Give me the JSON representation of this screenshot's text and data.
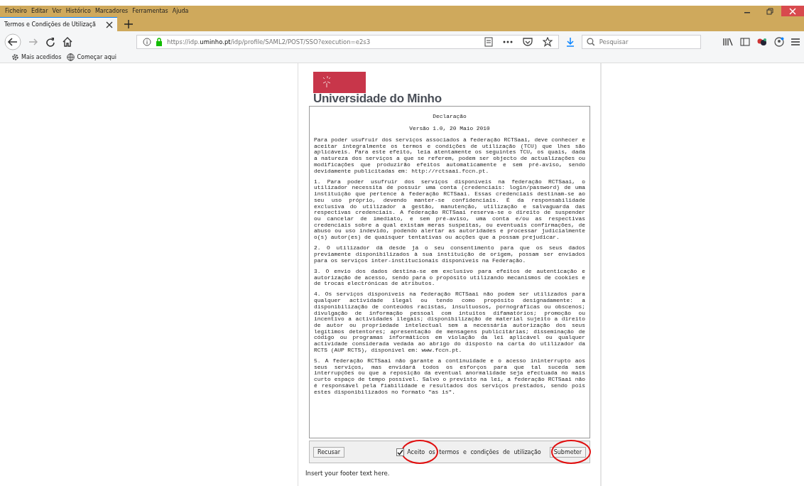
{
  "browser": {
    "menu": [
      "Ficheiro",
      "Editar",
      "Ver",
      "Histórico",
      "Marcadores",
      "Ferramentas",
      "Ajuda"
    ],
    "tab": {
      "title": "Termos e Condições de Utilizaçã",
      "selected": true
    },
    "url": {
      "start": "https://idp.",
      "domain": "uminho.pt",
      "path": "/idp/profile/SAML2/POST/SSO?execution=e2s3"
    },
    "search": {
      "placeholder": "Pesquisar"
    },
    "bookmarks": [
      "Mais acedidos",
      "Começar aqui"
    ]
  },
  "page": {
    "logo_text": "Universidade do Minho",
    "declaration": {
      "title": "Declaração",
      "version": "Versão 1.0, 20 Maio 2010",
      "paragraphs": [
        "Para poder usufruir dos serviços associados à federação RCTSaai, deve conhecer e aceitar integralmente os termos e condições de utilização (TCU) que lhes são aplicáveis. Para este efeito, leia atentamente os seguintes TCU, os quais, dada a natureza dos serviços a que se referem, podem ser objecto de actualizações ou modificações que produzirão efeitos automaticamente e sem pré-aviso, sendo devidamente publicitadas em: http://rctsaai.fccn.pt.",
        "1. Para poder usufruir dos serviços disponíveis na federação RCTSaai, o utilizador necessita de possuir uma conta (credenciais: login/password) de uma instituição que pertence à federação RCTSaai. Essas credenciais destinam-se ao seu uso próprio, devendo manter-se confidenciais. É da responsabilidade exclusiva do utilizador a gestão, manutenção, utilização e salvaguarda das respectivas credenciais. A federação RCTSaai reserva-se o direito de suspender ou cancelar de imediato, e sem pré-aviso, uma conta e/ou as respectivas credenciais sobre a qual existam meras suspeitas, ou eventuais confirmações, de abuso ou uso indevido, podendo alertar as autoridades e processar judicialmente o(s) autor(es) de quaisquer tentativas ou acções que a possam prejudicar.",
        "2. O utilizador dá desde já o seu consentimento para que os seus dados previamente disponibilizados à sua instituição de origem, possam ser enviados para os serviços inter-institucionais disponíveis na Federação.",
        "3. O envio dos dados destina-se em exclusivo para efeitos de autenticação e autorização de acesso, sendo para o propósito utilizando mecanismos de cookies e de trocas electrónicas de atributos.",
        "4. Os serviços disponíveis na federação RCTSaai não podem ser utilizados para qualquer actividade ilegal ou tendo como propósito designadamente: a disponibilização de conteúdos racistas, insultuosos, pornográficas ou obscenos; divulgação de informação pessoal com intuitos difamatórios; promoção ou incentivo a actividades ilegais; disponibilização de material sujeito a direito de autor ou propriedade intelectual sem a necessária autorização dos seus legítimos detentores; apresentação de mensagens publicitárias; disseminação de código ou programas informáticos em violação da lei aplicável ou qualquer actividade considerada vedada ao abrigo do disposto na carta do utilizador da RCTS (AUP RCTS), disponível em: www.fccn.pt.",
        "5. A federação RCTSaai não garante a continuidade e o acesso ininterrupto aos seus serviços, mas envidará todos os esforços para que tal suceda sem interrupções ou que a reposição da eventual anormalidade seja efectuada no mais curto espaço de tempo possível. Salvo o previsto na lei, a federação RCTSaai não é responsável pela fiabilidade e resultados dos serviços prestados, sendo pois estes disponibilizados no formato \"as is\"."
      ]
    },
    "form": {
      "decline_button": "Recusar",
      "accept": {
        "label": "Aceito os termos e condições de utilização",
        "checked": true,
        "highlighted": true
      },
      "submit": {
        "label": "Submeter",
        "highlighted": true
      }
    },
    "footer": "Insert your footer text here."
  }
}
